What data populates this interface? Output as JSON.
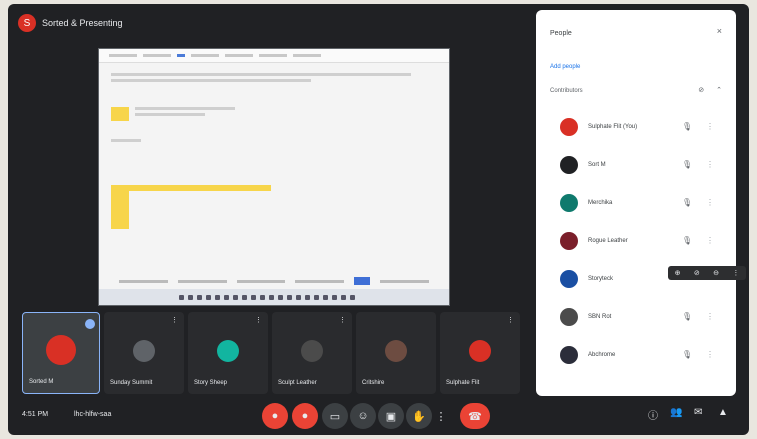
{
  "app": {
    "title": "Sorted & Presenting",
    "title_initial": "S"
  },
  "colors": {
    "background": "#202124",
    "panel": "#ffffff",
    "accent": "#8ab4f8",
    "danger": "#ea4335",
    "highlight": "#f7d54a"
  },
  "tiles": [
    {
      "name": "Sorted M",
      "color": "#d93025",
      "self": true
    },
    {
      "name": "Sunday Summit",
      "color": "#5f6368"
    },
    {
      "name": "Story Sheep",
      "color": "#12b5a0"
    },
    {
      "name": "Sculpt Leather",
      "color": "#4b4b4b"
    },
    {
      "name": "Critshire",
      "color": "#6d4c41"
    },
    {
      "name": "Sulphate Flit",
      "color": "#d93025"
    }
  ],
  "controls": {
    "clock": "4:51 PM",
    "meeting_code": "lhc-hlfw-saa",
    "mic_icon": "mic-off-icon",
    "cam_icon": "cam-off-icon",
    "captions_icon": "captions-icon",
    "emoji_icon": "emoji-icon",
    "present_icon": "present-icon",
    "hand_icon": "raise-hand-icon",
    "more_icon": "more-vert-icon",
    "end_icon": "call-end-icon",
    "info_icon": "info-icon",
    "people_icon": "people-icon",
    "chat_icon": "chat-icon",
    "activities_icon": "activities-icon"
  },
  "people_panel": {
    "title": "People",
    "close": "×",
    "add_people": "Add people",
    "section": "Contributors",
    "participants": [
      {
        "name": "Sulphate Flit (You)",
        "color": "#d93025"
      },
      {
        "name": "Sort M",
        "color": "#202124"
      },
      {
        "name": "Merchika",
        "color": "#0f7a6d"
      },
      {
        "name": "Rogue Leather",
        "color": "#7b1f2a"
      },
      {
        "name": "Storyteck",
        "color": "#1a4fa3"
      },
      {
        "name": "SBN Rot",
        "color": "#4b4b4b"
      },
      {
        "name": "Abchrome",
        "color": "#2b2d3a"
      }
    ]
  }
}
